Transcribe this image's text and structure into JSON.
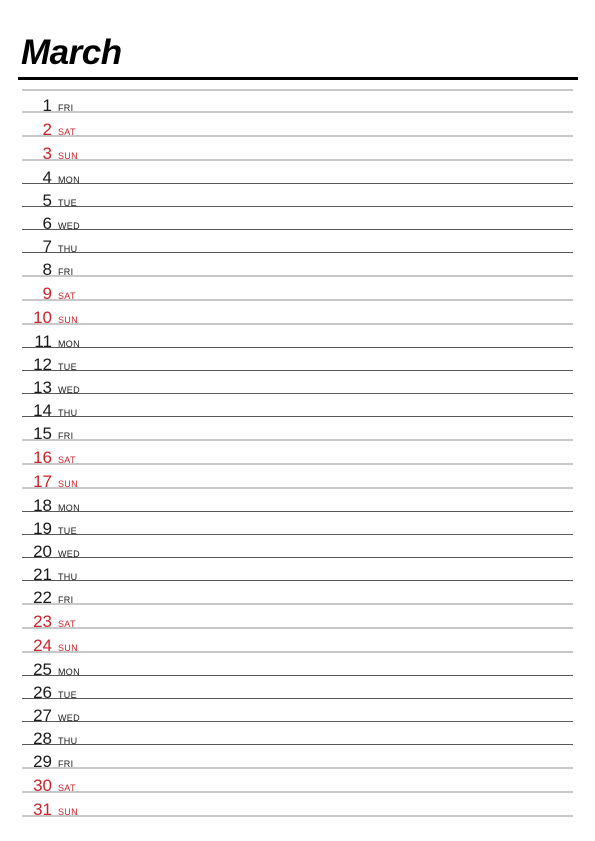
{
  "header": {
    "month_title": "March"
  },
  "colors": {
    "weekend_text": "#cc2229",
    "weekday_text": "#1a1a1a",
    "header_rule": "#000000",
    "weekday_divider": "#58585a",
    "weekend_divider": "#c8c8c8"
  },
  "calendar": {
    "days": [
      {
        "num": "1",
        "name": "FRI",
        "weekend": false
      },
      {
        "num": "2",
        "name": "SAT",
        "weekend": true
      },
      {
        "num": "3",
        "name": "SUN",
        "weekend": true
      },
      {
        "num": "4",
        "name": "MON",
        "weekend": false
      },
      {
        "num": "5",
        "name": "TUE",
        "weekend": false
      },
      {
        "num": "6",
        "name": "WED",
        "weekend": false
      },
      {
        "num": "7",
        "name": "THU",
        "weekend": false
      },
      {
        "num": "8",
        "name": "FRI",
        "weekend": false
      },
      {
        "num": "9",
        "name": "SAT",
        "weekend": true
      },
      {
        "num": "10",
        "name": "SUN",
        "weekend": true
      },
      {
        "num": "11",
        "name": "MON",
        "weekend": false
      },
      {
        "num": "12",
        "name": "TUE",
        "weekend": false
      },
      {
        "num": "13",
        "name": "WED",
        "weekend": false
      },
      {
        "num": "14",
        "name": "THU",
        "weekend": false
      },
      {
        "num": "15",
        "name": "FRI",
        "weekend": false
      },
      {
        "num": "16",
        "name": "SAT",
        "weekend": true
      },
      {
        "num": "17",
        "name": "SUN",
        "weekend": true
      },
      {
        "num": "18",
        "name": "MON",
        "weekend": false
      },
      {
        "num": "19",
        "name": "TUE",
        "weekend": false
      },
      {
        "num": "20",
        "name": "WED",
        "weekend": false
      },
      {
        "num": "21",
        "name": "THU",
        "weekend": false
      },
      {
        "num": "22",
        "name": "FRI",
        "weekend": false
      },
      {
        "num": "23",
        "name": "SAT",
        "weekend": true
      },
      {
        "num": "24",
        "name": "SUN",
        "weekend": true
      },
      {
        "num": "25",
        "name": "MON",
        "weekend": false
      },
      {
        "num": "26",
        "name": "TUE",
        "weekend": false
      },
      {
        "num": "27",
        "name": "WED",
        "weekend": false
      },
      {
        "num": "28",
        "name": "THU",
        "weekend": false
      },
      {
        "num": "29",
        "name": "FRI",
        "weekend": false
      },
      {
        "num": "30",
        "name": "SAT",
        "weekend": true
      },
      {
        "num": "31",
        "name": "SUN",
        "weekend": true
      }
    ]
  }
}
